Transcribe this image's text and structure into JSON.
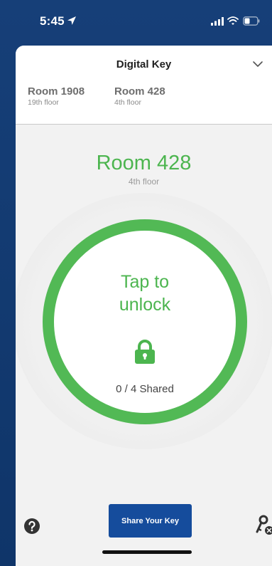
{
  "status_bar": {
    "time": "5:45"
  },
  "header": {
    "title": "Digital Key"
  },
  "rooms": [
    {
      "name": "Room 1908",
      "floor": "19th floor"
    },
    {
      "name": "Room 428",
      "floor": "4th floor"
    }
  ],
  "current_room": {
    "name": "Room 428",
    "floor": "4th floor"
  },
  "unlock": {
    "label_line1": "Tap to",
    "label_line2": "unlock",
    "shared_status": "0 / 4 Shared"
  },
  "footer": {
    "share_label": "Share Your Key"
  },
  "colors": {
    "accent_green": "#52b955",
    "button_blue": "#154c9c",
    "background_blue": "#0f3569"
  },
  "icons": {
    "location": "location-arrow-icon",
    "signal": "signal-icon",
    "wifi": "wifi-icon",
    "battery": "battery-icon",
    "chevron": "chevron-down-icon",
    "lock": "lock-icon",
    "help": "help-icon",
    "key": "key-icon"
  }
}
